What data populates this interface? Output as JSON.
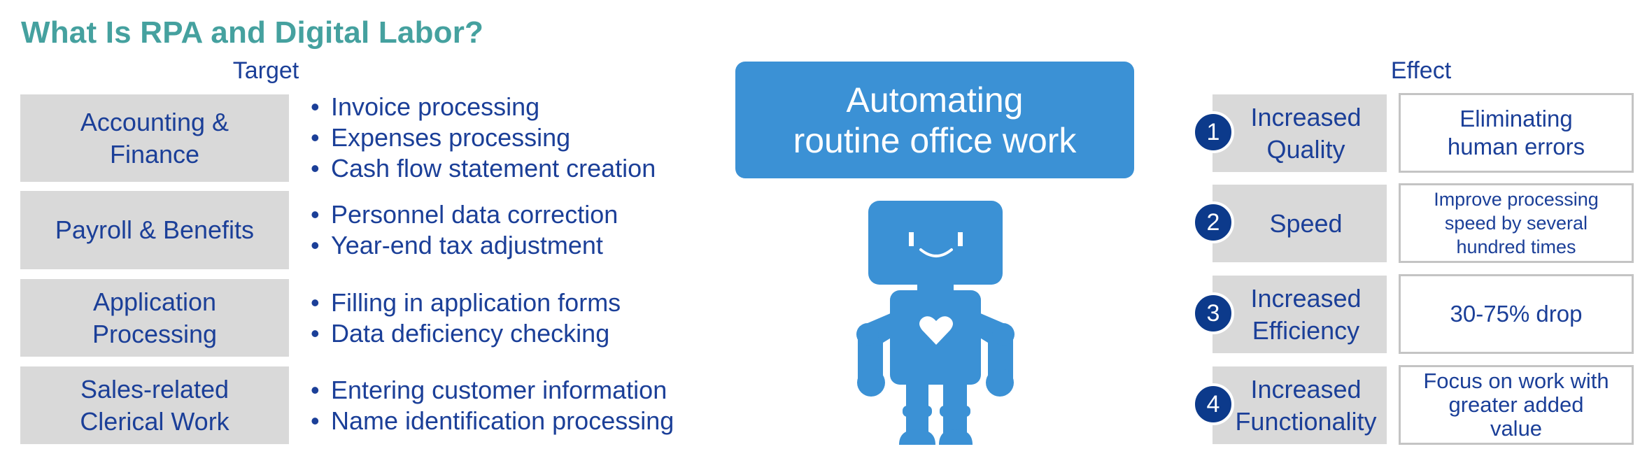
{
  "title": "What Is RPA and Digital Labor?",
  "target": {
    "header": "Target",
    "categories": [
      {
        "label_lines": [
          "Accounting &",
          "Finance"
        ],
        "tasks": [
          "Invoice processing",
          "Expenses processing",
          "Cash flow statement creation"
        ]
      },
      {
        "label_lines": [
          "Payroll & Benefits"
        ],
        "tasks": [
          "Personnel data correction",
          "Year-end tax adjustment"
        ]
      },
      {
        "label_lines": [
          "Application",
          "Processing"
        ],
        "tasks": [
          "Filling in application forms",
          "Data deficiency checking"
        ]
      },
      {
        "label_lines": [
          "Sales-related",
          "Clerical Work"
        ],
        "tasks": [
          "Entering customer information",
          "Name identification processing"
        ]
      }
    ],
    "bullet_glyph": "•"
  },
  "center": {
    "headline_lines": [
      "Automating",
      "routine office work"
    ],
    "illustration": "robot-icon",
    "accent_color": "#3b91d5"
  },
  "effect": {
    "header": "Effect",
    "items": [
      {
        "number": "1",
        "label_lines": [
          "Increased",
          "Quality"
        ],
        "detail_lines": [
          "Eliminating",
          "human errors"
        ]
      },
      {
        "number": "2",
        "label_lines": [
          "Speed"
        ],
        "detail_lines": [
          "Improve processing",
          "speed by several",
          "hundred times"
        ]
      },
      {
        "number": "3",
        "label_lines": [
          "Increased",
          "Efficiency"
        ],
        "detail_lines": [
          "30-75% drop"
        ]
      },
      {
        "number": "4",
        "label_lines": [
          "Increased",
          "Functionality"
        ],
        "detail_lines": [
          "Focus on work with",
          "greater added",
          "value"
        ]
      }
    ]
  },
  "colors": {
    "title": "#45a19f",
    "text": "#1b3f98",
    "box_fill": "#d9d9d9",
    "number_circle": "#0c3a8b",
    "detail_border": "#c4c4c4"
  }
}
